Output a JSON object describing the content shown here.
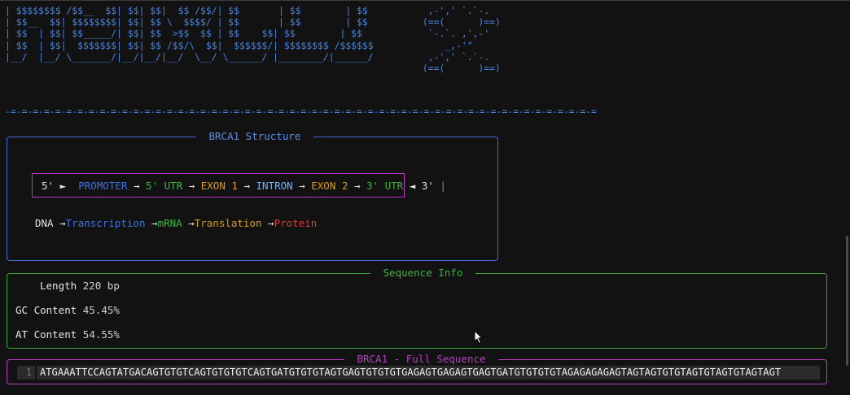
{
  "banner": {
    "ascii_lines": [
      "| $$$$$$$$ /$$__  $$| $$| $$|  $$ /$$/| $$       | $$        | $$",
      "| $$__  $$| $$$$$$$$| $$| $$ \\  $$$$/ | $$       | $$        | $$",
      "| $$  | $$| $$_____/| $$| $$  >$$  $$ | $$    $$| $$        | $$",
      "| $$  | $$|  $$$$$$$| $$| $$ /$$/\\  $$|  $$$$$$/| $$$$$$$$ /$$$$$$",
      "|__/  |__/ \\_______/|__/|__/|__/  \\__/ \\______/ |________/|______/"
    ],
    "dna_art_lines": [
      "  ,-',' `.`-.",
      " (==(      )==)",
      "  `-.`. ,',-'",
      "     _,-'\"",
      "  ,-',' `.`-.",
      " (==(      )==)"
    ],
    "divider": "-=-=-=-=-=-=-=-=-=-=-=-=-=-=-=-=-=-=-=-=-=-=-=-=-=-=-=-=-=-=-=-=-=-=-=-=-=-=-=-=-=-=-=-=-=-=-=-=-=-=-=-=-="
  },
  "structure": {
    "title": " BRCA1 Structure ",
    "flow": {
      "five_prime": "5'",
      "right_tri": "►",
      "promoter": "PROMOTER",
      "arrow": "→",
      "five_utr": "5' UTR",
      "exon1": "EXON 1",
      "intron": "INTRON",
      "exon2": "EXON 2",
      "three_utr": "3' UTR",
      "left_tri": "◄",
      "three_prime": "3'",
      "bar": "|"
    },
    "central": {
      "dna": "DNA",
      "arrow": "→",
      "transcription": "Transcription",
      "mrna": "mRNA",
      "translation": "Translation",
      "protein": "Protein"
    }
  },
  "info": {
    "title": " Sequence Info ",
    "length_label": "Length",
    "length_value": "220 bp",
    "gc_label": "GC Content",
    "gc_value": "45.45%",
    "at_label": "AT Content",
    "at_value": "54.55%"
  },
  "sequence": {
    "title": " BRCA1 - Full Sequence ",
    "line_number": "1",
    "text": "ATGAAATTCCAGTATGACAGTGTGTCAGTGTGTGTCAGTGATGTGTGTAGTGAGTGTGTGTGAGAGTGAGAGTGAGTGATGTGTGTGTAGAGAGAGAGTAGTAGTGTGTAGTGTAGTGTAGTAGT"
  },
  "colors": {
    "background": "#121212",
    "structure_border": "#3f6fd1",
    "info_border": "#3aa03a",
    "sequence_border": "#b43cbf",
    "promoter": "#3d6fe0",
    "utr": "#3fb33f",
    "exon": "#d69a1f",
    "protein": "#d13c3c"
  }
}
